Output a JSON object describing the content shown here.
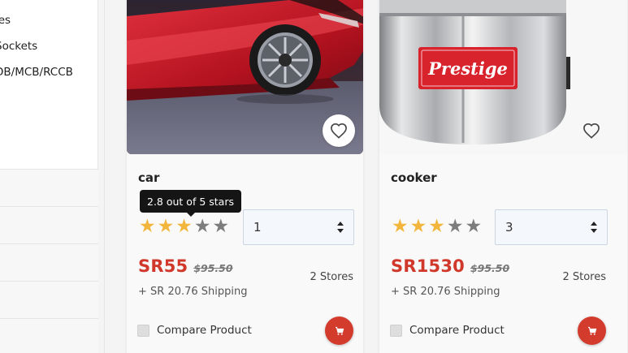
{
  "sidebar": {
    "categories": [
      "les",
      "Sockets",
      "DB/MCB/RCCB"
    ]
  },
  "products": [
    {
      "name": "car",
      "rating_tooltip": "2.8 out of 5 stars",
      "rating": 2.8,
      "quantity": "1",
      "price": "SR55",
      "old_price": "$95.50",
      "shipping": "+ SR 20.76 Shipping",
      "stores": "2 Stores",
      "compare_label": "Compare Product",
      "image": "red-car-photo"
    },
    {
      "name": "cooker",
      "rating": 3,
      "quantity": "3",
      "price": "SR1530",
      "old_price": "$95.50",
      "shipping": "+ SR 20.76 Shipping",
      "stores": "2 Stores",
      "compare_label": "Compare Product",
      "image": "prestige-pressure-cooker-photo",
      "brand_logo_text": "Prestige"
    }
  ],
  "icons": {
    "wishlist": "heart-icon",
    "cart": "cart-icon",
    "star": "star-icon",
    "select": "select-arrows-icon"
  },
  "colors": {
    "accent": "#d33b2c",
    "price": "#d0382b",
    "star_filled": "#f3b63d",
    "star_empty": "#7d7d7d",
    "tooltip_bg": "#151515"
  }
}
